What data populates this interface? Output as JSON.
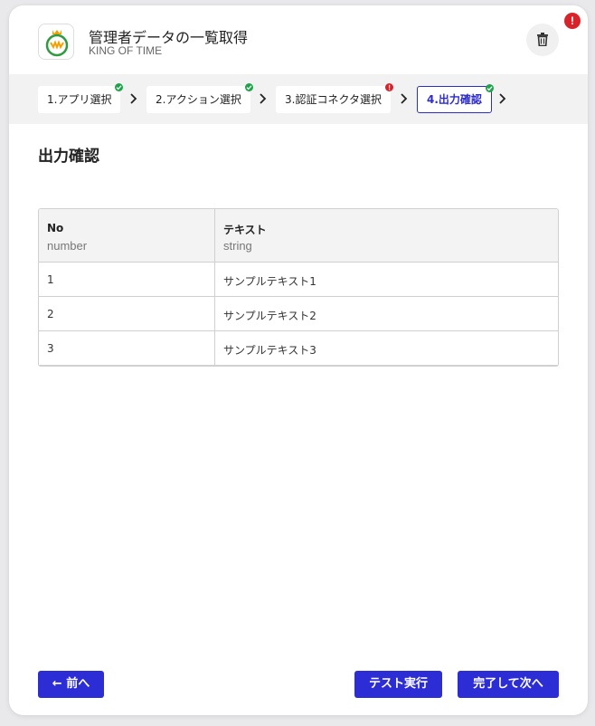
{
  "header": {
    "title": "管理者データの一覧取得",
    "subtitle": "KING OF TIME",
    "alert_badge": "!"
  },
  "steps": [
    {
      "label": "1.アプリ選択",
      "status": "ok",
      "active": false
    },
    {
      "label": "2.アクション選択",
      "status": "ok",
      "active": false
    },
    {
      "label": "3.認証コネクタ選択",
      "status": "error",
      "active": false
    },
    {
      "label": "4.出力確認",
      "status": "ok",
      "active": true
    }
  ],
  "section_title": "出力確認",
  "table": {
    "columns": [
      {
        "name": "No",
        "type": "number"
      },
      {
        "name": "テキスト",
        "type": "string"
      }
    ],
    "rows": [
      [
        "1",
        "サンプルテキスト1"
      ],
      [
        "2",
        "サンプルテキスト2"
      ],
      [
        "3",
        "サンプルテキスト3"
      ]
    ]
  },
  "footer": {
    "back_label": "← 前へ",
    "test_label": "テスト実行",
    "next_label": "完了して次へ"
  },
  "colors": {
    "accent": "#2d2dd6",
    "ok": "#1fa34a",
    "error": "#d8232a"
  },
  "icons": {
    "delete": "trash-icon",
    "next": "chevron-right-icon",
    "ok": "check-icon",
    "error": "exclamation-icon"
  }
}
